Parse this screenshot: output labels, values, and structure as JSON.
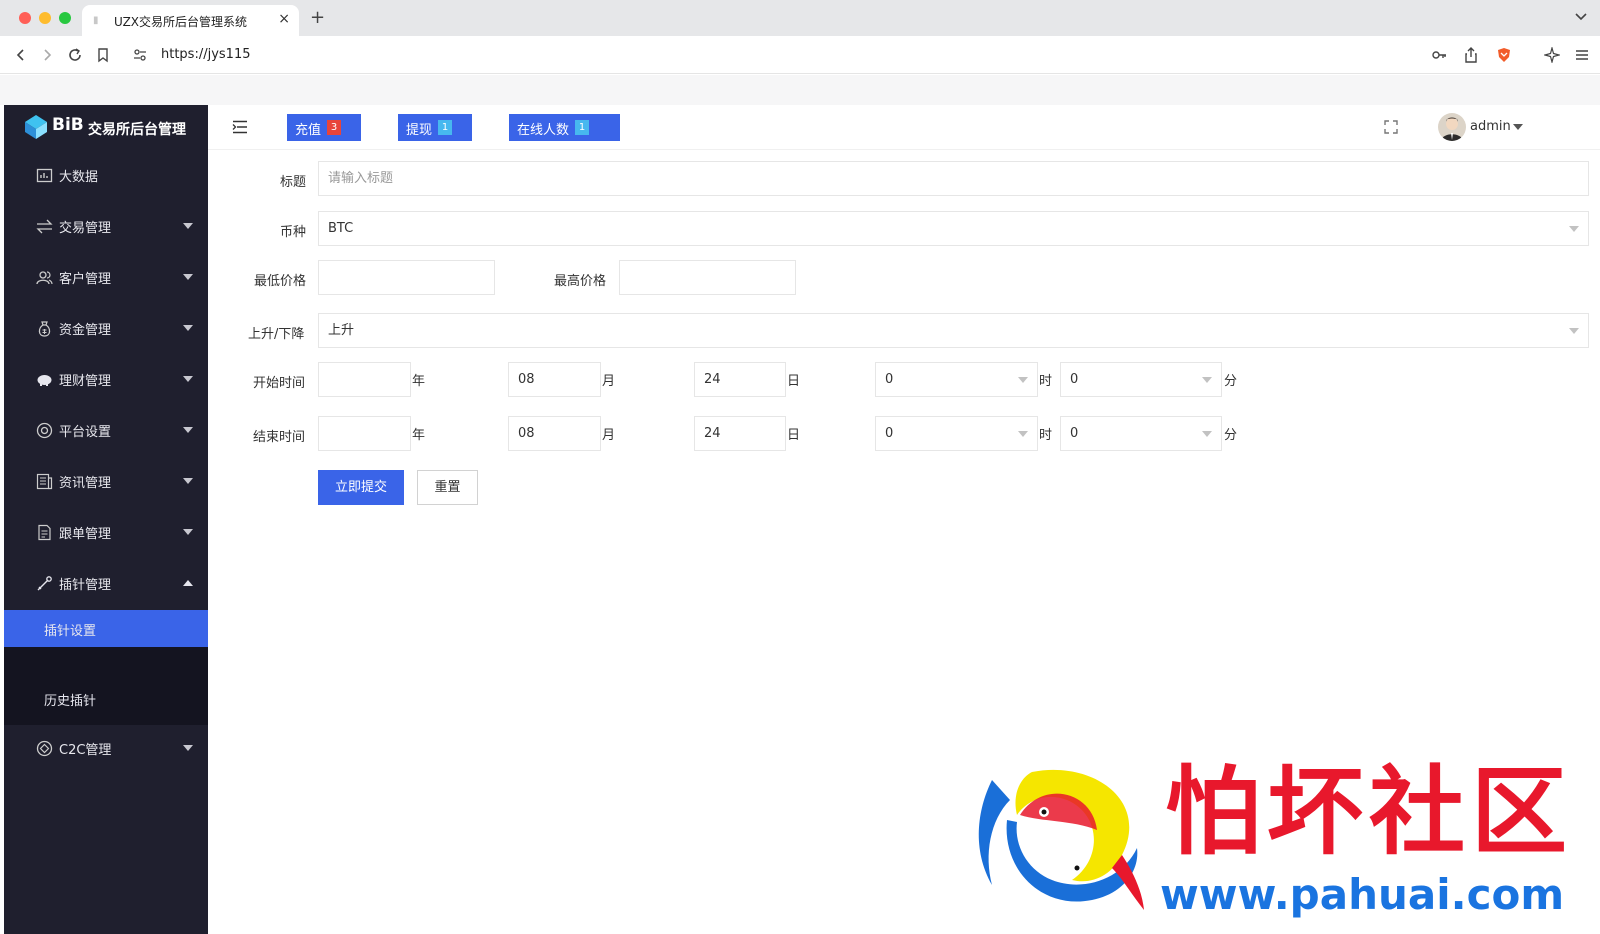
{
  "browser": {
    "tab_title": "UZX交易所后台管理系统",
    "tab_close": "×",
    "new_tab": "+",
    "url": "https://jys115"
  },
  "sidebar": {
    "brand_name": "BiB",
    "brand_title": "交易所后台管理",
    "items": [
      {
        "label": "大数据",
        "icon": "chart-icon"
      },
      {
        "label": "交易管理",
        "icon": "exchange-icon"
      },
      {
        "label": "客户管理",
        "icon": "users-icon"
      },
      {
        "label": "资金管理",
        "icon": "money-bag-icon"
      },
      {
        "label": "理财管理",
        "icon": "piggy-bank-icon"
      },
      {
        "label": "平台设置",
        "icon": "settings-icon"
      },
      {
        "label": "资讯管理",
        "icon": "news-icon"
      },
      {
        "label": "跟单管理",
        "icon": "document-icon"
      },
      {
        "label": "插针管理",
        "icon": "needle-icon"
      }
    ],
    "sub_items": [
      {
        "label": "插针设置",
        "active": true
      },
      {
        "label": "历史插针",
        "active": false
      }
    ],
    "last_item": {
      "label": "C2C管理",
      "icon": "c2c-icon"
    }
  },
  "header": {
    "recharge_label": "充值",
    "recharge_count": "3",
    "withdraw_label": "提现",
    "withdraw_count": "1",
    "online_label": "在线人数",
    "online_count": "1",
    "username": "admin",
    "accent_color": "#3a64e8"
  },
  "form": {
    "title_label": "标题",
    "title_placeholder": "请输入标题",
    "title_value": "",
    "currency_label": "币种",
    "currency_value": "BTC",
    "min_price_label": "最低价格",
    "min_price_value": "",
    "max_price_label": "最高价格",
    "max_price_value": "",
    "direction_label": "上升/下降",
    "direction_value": "上升",
    "start_label": "开始时间",
    "end_label": "结束时间",
    "start": {
      "year": "",
      "month": "08",
      "day": "24",
      "hour": "0",
      "minute": "0"
    },
    "end": {
      "year": "",
      "month": "08",
      "day": "24",
      "hour": "0",
      "minute": "0"
    },
    "units": {
      "year": "年",
      "month": "月",
      "day": "日",
      "hour": "时",
      "minute": "分"
    },
    "submit_label": "立即提交",
    "reset_label": "重置"
  },
  "watermark": {
    "title": "怕坏社区",
    "url": "www.pahuai.com"
  }
}
